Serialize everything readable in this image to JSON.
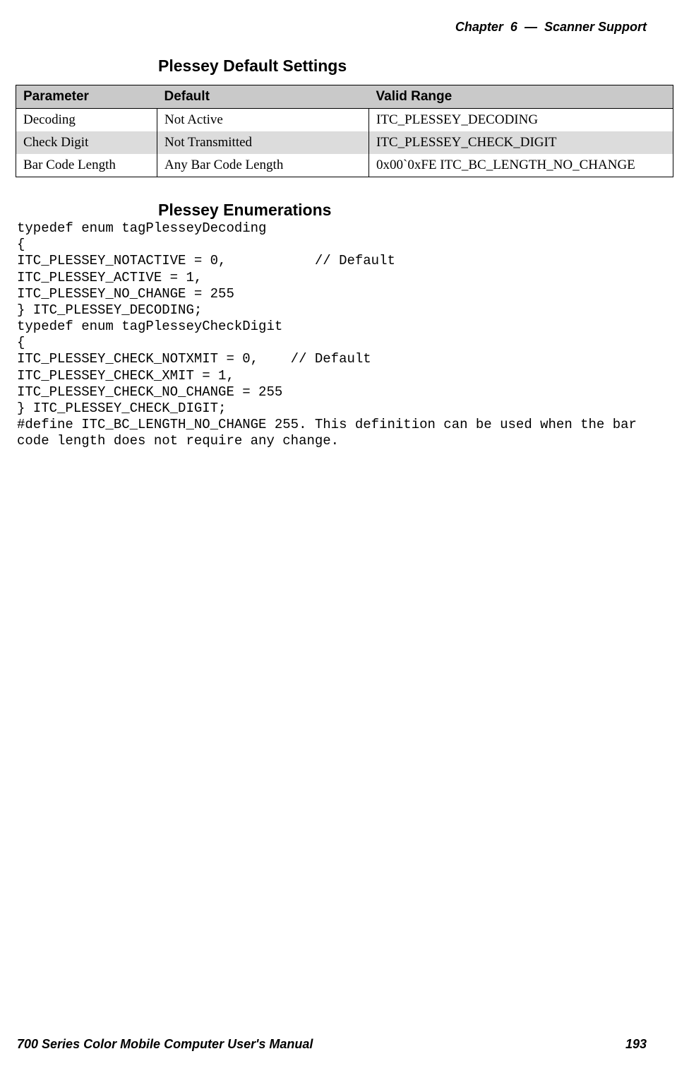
{
  "header": {
    "chapter_label": "Chapter",
    "chapter_number": "6",
    "separator": "—",
    "title": "Scanner Support"
  },
  "headings": {
    "section1": "Plessey Default Settings",
    "section2": "Plessey Enumerations"
  },
  "table": {
    "headers": {
      "parameter": "Parameter",
      "default": "Default",
      "valid_range": "Valid Range"
    },
    "rows": [
      {
        "parameter": "Decoding",
        "default": "Not Active",
        "valid_range": "ITC_PLESSEY_DECODING"
      },
      {
        "parameter": "Check Digit",
        "default": "Not Transmitted",
        "valid_range": "ITC_PLESSEY_CHECK_DIGIT"
      },
      {
        "parameter": "Bar Code Length",
        "default": "Any Bar Code Length",
        "valid_range": "0x00`0xFE     ITC_BC_LENGTH_NO_CHANGE"
      }
    ]
  },
  "code_block": "typedef enum tagPlesseyDecoding\n{\nITC_PLESSEY_NOTACTIVE = 0,           // Default\nITC_PLESSEY_ACTIVE = 1,\nITC_PLESSEY_NO_CHANGE = 255\n} ITC_PLESSEY_DECODING;\ntypedef enum tagPlesseyCheckDigit\n{\nITC_PLESSEY_CHECK_NOTXMIT = 0,    // Default\nITC_PLESSEY_CHECK_XMIT = 1,\nITC_PLESSEY_CHECK_NO_CHANGE = 255\n} ITC_PLESSEY_CHECK_DIGIT;\n#define ITC_BC_LENGTH_NO_CHANGE 255. This definition can be used when the bar\ncode length does not require any change.",
  "footer": {
    "manual_title": "700 Series Color Mobile Computer User's Manual",
    "page_number": "193"
  }
}
